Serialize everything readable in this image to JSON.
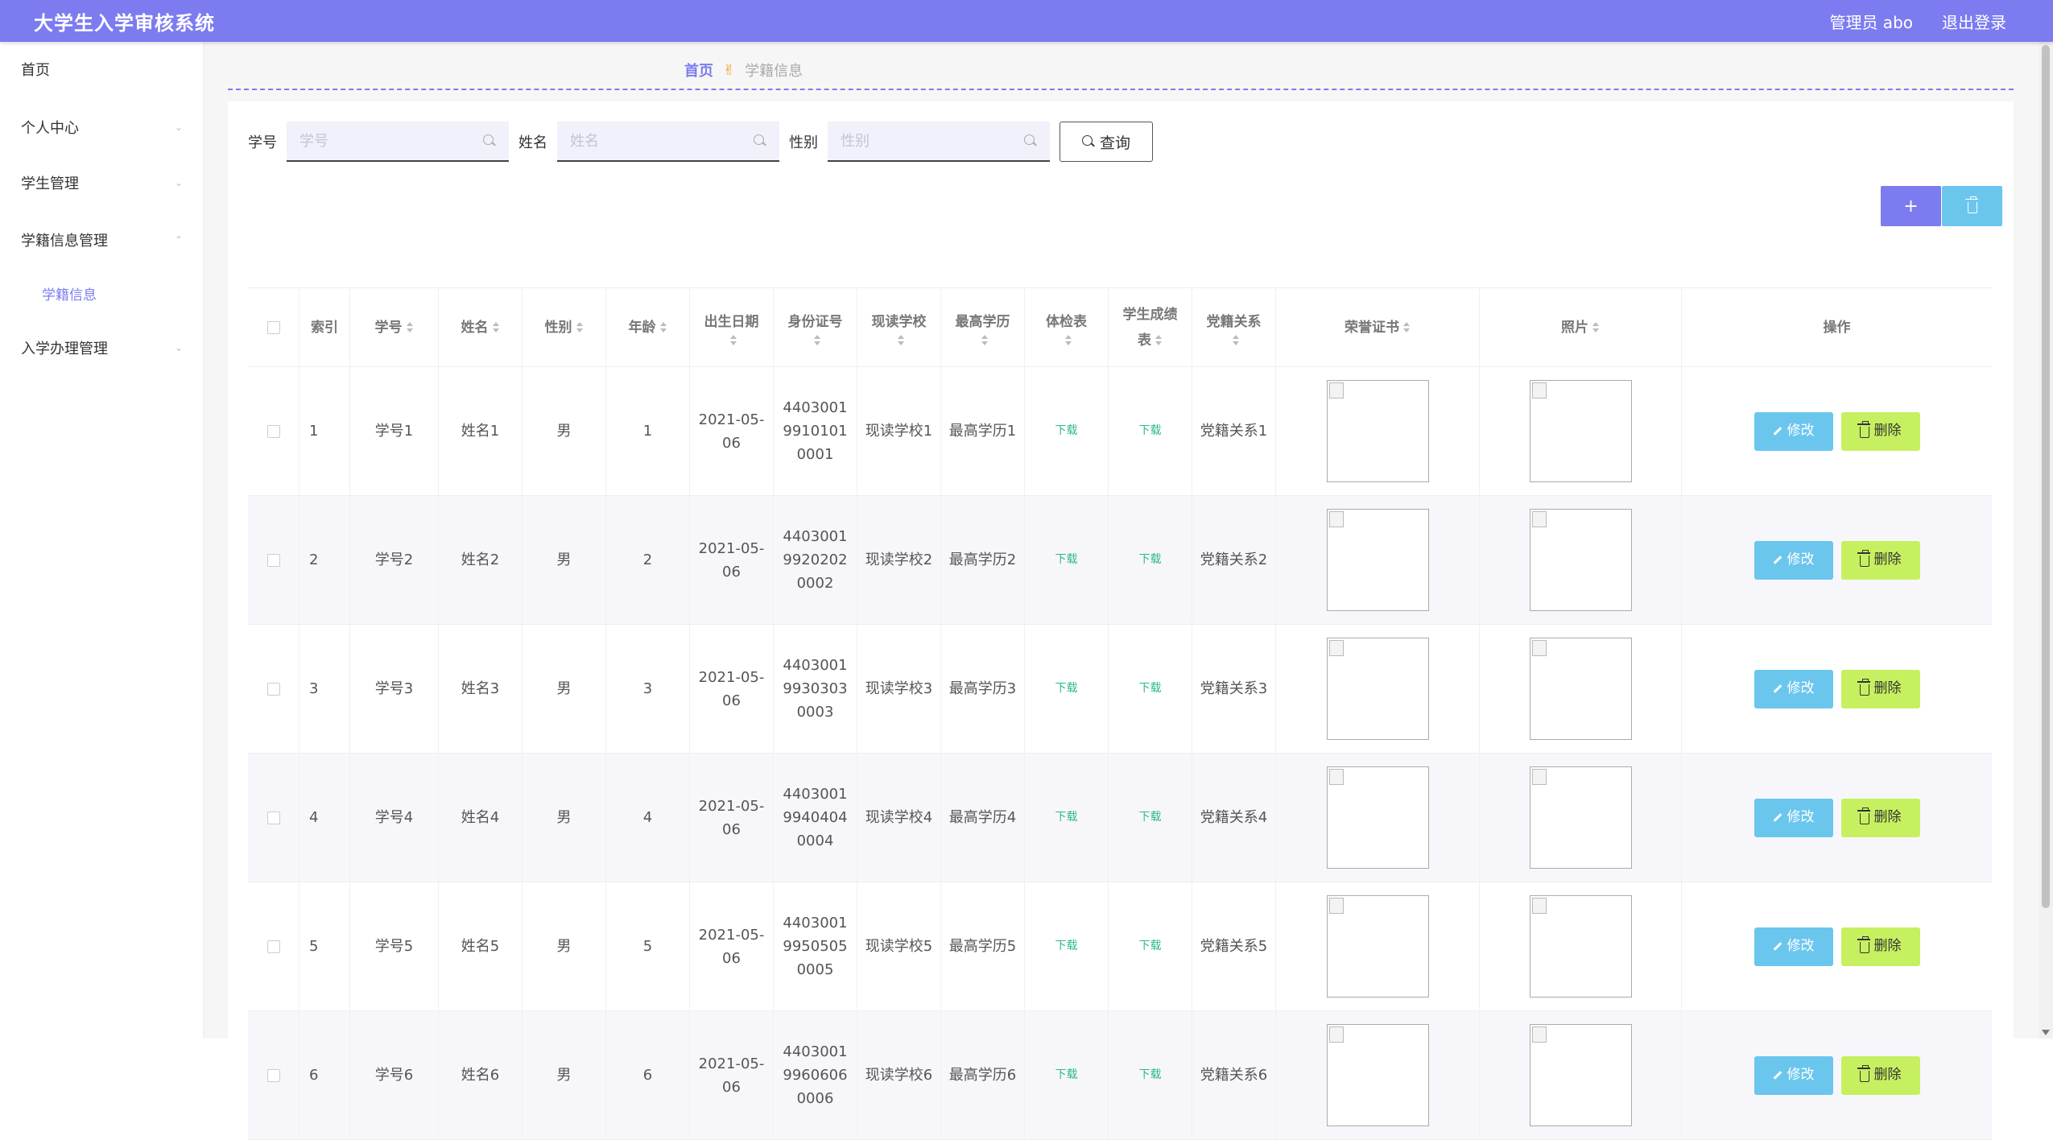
{
  "header": {
    "title": "大学生入学审核系统",
    "user": "管理员 abo",
    "logout": "退出登录"
  },
  "sidebar": {
    "items": [
      {
        "label": "首页",
        "expandable": false
      },
      {
        "label": "个人中心",
        "expandable": true
      },
      {
        "label": "学生管理",
        "expandable": true
      },
      {
        "label": "学籍信息管理",
        "expandable": true,
        "expanded": true
      },
      {
        "label": "学籍信息",
        "sub": true
      },
      {
        "label": "入学办理管理",
        "expandable": true
      }
    ]
  },
  "breadcrumb": {
    "home": "首页",
    "current": "学籍信息"
  },
  "search": {
    "xuehao_label": "学号",
    "xuehao_placeholder": "学号",
    "name_label": "姓名",
    "name_placeholder": "姓名",
    "gender_label": "性别",
    "gender_placeholder": "性别",
    "query_label": "查询"
  },
  "toolbar": {
    "add_label": "+"
  },
  "table": {
    "headers": {
      "index": "索引",
      "xuehao": "学号",
      "name": "姓名",
      "gender": "性别",
      "age": "年龄",
      "birth": "出生日期",
      "idcard": "身份证号",
      "school": "现读学校",
      "degree": "最高学历",
      "physical": "体检表",
      "grades_1": "学生成绩",
      "grades_2": "表",
      "party": "党籍关系",
      "honor": "荣誉证书",
      "photo": "照片",
      "ops": "操作"
    },
    "download_label": "下载",
    "edit_label": "修改",
    "delete_label": "删除",
    "rows": [
      {
        "index": "1",
        "xuehao": "学号1",
        "name": "姓名1",
        "gender": "男",
        "age": "1",
        "birth": "2021-05-06",
        "idcard": "440300199101010001",
        "school": "现读学校1",
        "degree": "最高学历1",
        "party": "党籍关系1"
      },
      {
        "index": "2",
        "xuehao": "学号2",
        "name": "姓名2",
        "gender": "男",
        "age": "2",
        "birth": "2021-05-06",
        "idcard": "440300199202020002",
        "school": "现读学校2",
        "degree": "最高学历2",
        "party": "党籍关系2"
      },
      {
        "index": "3",
        "xuehao": "学号3",
        "name": "姓名3",
        "gender": "男",
        "age": "3",
        "birth": "2021-05-06",
        "idcard": "440300199303030003",
        "school": "现读学校3",
        "degree": "最高学历3",
        "party": "党籍关系3"
      },
      {
        "index": "4",
        "xuehao": "学号4",
        "name": "姓名4",
        "gender": "男",
        "age": "4",
        "birth": "2021-05-06",
        "idcard": "440300199404040004",
        "school": "现读学校4",
        "degree": "最高学历4",
        "party": "党籍关系4"
      },
      {
        "index": "5",
        "xuehao": "学号5",
        "name": "姓名5",
        "gender": "男",
        "age": "5",
        "birth": "2021-05-06",
        "idcard": "440300199505050005",
        "school": "现读学校5",
        "degree": "最高学历5",
        "party": "党籍关系5"
      },
      {
        "index": "6",
        "xuehao": "学号6",
        "name": "姓名6",
        "gender": "男",
        "age": "6",
        "birth": "2021-05-06",
        "idcard": "440300199606060006",
        "school": "现读学校6",
        "degree": "最高学历6",
        "party": "党籍关系6"
      }
    ]
  },
  "colors": {
    "accent": "#7c7cf0",
    "info": "#6bc6ee",
    "lime": "#c6f060",
    "download": "#2eb88a"
  }
}
